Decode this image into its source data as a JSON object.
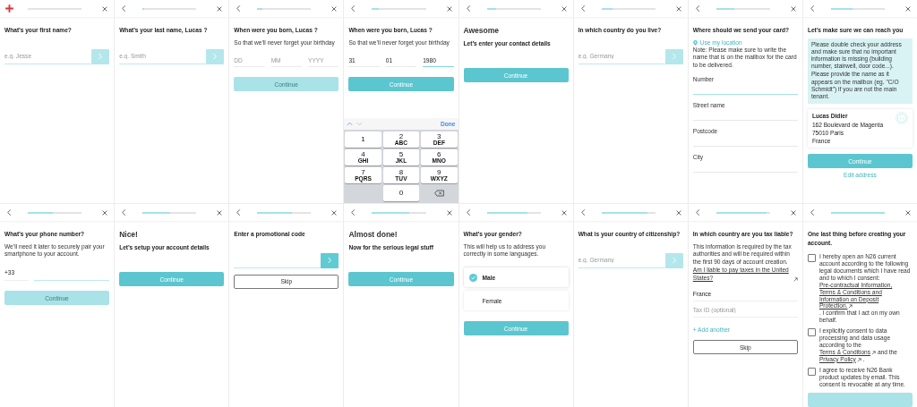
{
  "screens": [
    {
      "header": {
        "kind": "flag",
        "progress": {
          "level": 0
        }
      },
      "items": [
        {
          "kind": "title",
          "text": "What’s your first name?"
        },
        {
          "kind": "input_arrow",
          "placeholder": "e.g. Jesse",
          "enabled": false
        }
      ]
    },
    {
      "header": {
        "kind": "back",
        "progress": {
          "level": 0.03
        }
      },
      "items": [
        {
          "kind": "title",
          "text": "What’s your last name, Lucas ?"
        },
        {
          "kind": "input_arrow",
          "placeholder": "e.g. Smith",
          "enabled": false
        }
      ]
    },
    {
      "header": {
        "kind": "back",
        "progress": {
          "level": 0.1
        }
      },
      "items": [
        {
          "kind": "title",
          "text": "When were you born, Lucas ?"
        },
        {
          "kind": "text",
          "text": "So that we’ll never forget your birthday"
        },
        {
          "kind": "date",
          "fields": [
            {
              "placeholder": "DD",
              "active": false
            },
            {
              "placeholder": "MM",
              "active": false
            },
            {
              "placeholder": "YYYY",
              "active": false
            }
          ]
        },
        {
          "kind": "button",
          "label": "Continue",
          "disabled": true
        }
      ]
    },
    {
      "header": {
        "kind": "back",
        "progress": {
          "level": 0.12
        }
      },
      "items": [
        {
          "kind": "title",
          "text": "When were you born, Lucas ?"
        },
        {
          "kind": "text",
          "text": "So that we’ll never forget your birthday"
        },
        {
          "kind": "date",
          "fields": [
            {
              "value": "31",
              "active": false
            },
            {
              "value": "01",
              "active": false
            },
            {
              "value": "1980",
              "active": true
            }
          ]
        },
        {
          "kind": "button",
          "label": "Continue",
          "disabled": false
        },
        {
          "kind": "keypad",
          "done": "Done",
          "keys": [
            {
              "digit": "1"
            },
            {
              "digit": "2",
              "letters": "ABC"
            },
            {
              "digit": "3",
              "letters": "DEF"
            },
            {
              "digit": "4",
              "letters": "GHI"
            },
            {
              "digit": "5",
              "letters": "JKL"
            },
            {
              "digit": "6",
              "letters": "MNO"
            },
            {
              "digit": "7",
              "letters": "PQRS"
            },
            {
              "digit": "8",
              "letters": "TUV"
            },
            {
              "digit": "9",
              "letters": "WXYZ"
            },
            {
              "digit": "0"
            }
          ]
        }
      ]
    },
    {
      "header": {
        "kind": "back",
        "progress": {
          "level": 0.18
        }
      },
      "items": [
        {
          "kind": "heading",
          "text": "Awesome"
        },
        {
          "kind": "lead",
          "text": "Let’s enter your contact details"
        },
        {
          "kind": "button",
          "label": "Continue",
          "disabled": false
        }
      ]
    },
    {
      "header": {
        "kind": "back",
        "progress": {
          "level": 0.2
        }
      },
      "items": [
        {
          "kind": "title",
          "text": "In which country do you live?"
        },
        {
          "kind": "input_arrow",
          "placeholder": "e.g. Germany",
          "enabled": false
        }
      ]
    },
    {
      "header": {
        "kind": "back",
        "progress": {
          "level": 0.34
        }
      },
      "items": [
        {
          "kind": "title",
          "text": "Where should we send your card?"
        },
        {
          "kind": "location",
          "text": "Use my location"
        },
        {
          "kind": "note",
          "text": "Note: Please make sure to write the name that is on the mailbox for the card to be delivered."
        },
        {
          "kind": "labeled_field",
          "label": "Number",
          "active": true
        },
        {
          "kind": "labeled_field",
          "label": "Street name",
          "active": false
        },
        {
          "kind": "labeled_field",
          "label": "Postcode",
          "active": false
        },
        {
          "kind": "labeled_field",
          "label": "City",
          "active": false
        }
      ]
    },
    {
      "header": {
        "kind": "back",
        "progress": {
          "level": 0.4
        }
      },
      "items": [
        {
          "kind": "title",
          "text": "Let’s make sure we can reach you"
        },
        {
          "kind": "info",
          "paragraphs": [
            "Please double check your address and make sure that no important information is missing (building number, stairwell, door code...).",
            "Please provide the name as it appears on the mailbox (eg. \"C/O Schmidt\") if you are not the main tenant."
          ]
        },
        {
          "kind": "address",
          "lines": [
            "Lucas Didier",
            "162 Boulevard de Magenta",
            "75010 Paris",
            "France"
          ]
        },
        {
          "kind": "button",
          "label": "Continue",
          "disabled": false
        },
        {
          "kind": "link",
          "text": "Edit address"
        }
      ]
    },
    {
      "header": {
        "kind": "back",
        "progress": {
          "level": 0.46
        }
      },
      "items": [
        {
          "kind": "title",
          "text": "What’s your phone number?"
        },
        {
          "kind": "text",
          "text": "We’ll need it later to securely pair your smartphone to your account."
        },
        {
          "kind": "phone",
          "prefix": "+33"
        },
        {
          "kind": "button",
          "label": "Continue",
          "disabled": true
        }
      ]
    },
    {
      "header": {
        "kind": "back",
        "progress": {
          "level": 0.52
        }
      },
      "items": [
        {
          "kind": "heading",
          "text": "Nice!"
        },
        {
          "kind": "lead",
          "text": "Let’s setup your account details"
        },
        {
          "kind": "button",
          "label": "Continue",
          "disabled": false
        }
      ]
    },
    {
      "header": {
        "kind": "back",
        "progress": {
          "level": 0.64
        }
      },
      "items": [
        {
          "kind": "title",
          "text": "Enter a promotional code"
        },
        {
          "kind": "input_arrow",
          "enabled": true
        },
        {
          "kind": "outline_button",
          "label": "Skip",
          "disabled": false
        }
      ]
    },
    {
      "header": {
        "kind": "back",
        "progress": {
          "level": 0.7
        }
      },
      "items": [
        {
          "kind": "heading",
          "text": "Almost done!"
        },
        {
          "kind": "lead",
          "text": "Now for the serious legal stuff"
        },
        {
          "kind": "button",
          "label": "Continue",
          "disabled": false
        }
      ]
    },
    {
      "header": {
        "kind": "back",
        "progress": {
          "level": 0.76
        }
      },
      "items": [
        {
          "kind": "title",
          "text": "What’s your gender?"
        },
        {
          "kind": "text",
          "text": "This will help us to address you correctly in some languages."
        },
        {
          "kind": "choices",
          "options": [
            {
              "label": "Male",
              "selected": true
            },
            {
              "label": "Female",
              "selected": false
            }
          ]
        },
        {
          "kind": "button",
          "label": "Continue",
          "disabled": false
        }
      ]
    },
    {
      "header": {
        "kind": "back",
        "progress": {
          "level": 0.85
        }
      },
      "items": [
        {
          "kind": "title",
          "text": "What is your country of citizenship?"
        },
        {
          "kind": "input_arrow",
          "placeholder": "e.g. Germany",
          "enabled": false
        }
      ]
    },
    {
      "header": {
        "kind": "back",
        "progress": {
          "level": 0.93
        }
      },
      "items": [
        {
          "kind": "title",
          "text": "In which country are you tax liable?"
        },
        {
          "kind": "text",
          "text": "This information is required by the tax authorities and will be required within the first 90 days of account creation."
        },
        {
          "kind": "ext_link",
          "text": "Am I liable to pay taxes in the United States?"
        },
        {
          "kind": "plain_field",
          "value": "France"
        },
        {
          "kind": "plain_field",
          "placeholder": "Tax ID (optional)"
        },
        {
          "kind": "link",
          "text": "+ Add another"
        },
        {
          "kind": "outline_button",
          "label": "Skip",
          "disabled": false
        }
      ]
    },
    {
      "header": {
        "kind": "back",
        "progress": {
          "level": 1
        }
      },
      "items": [
        {
          "kind": "title",
          "text": "One last thing before creating your account."
        },
        {
          "kind": "consent",
          "checked": false,
          "segments": [
            {
              "kind": "text",
              "text": "I hereby open an N26 current account according to the following legal documents which I have read and to which I consent:"
            },
            {
              "kind": "link_line",
              "text": "Pre-contractual Information,"
            },
            {
              "kind": "link_line",
              "text": "Terms & Conditions and"
            },
            {
              "kind": "link_line",
              "text": "Information on Deposit"
            },
            {
              "kind": "link_line",
              "text": "Protection.",
              "external": true
            },
            {
              "kind": "text",
              "text": ". I confirm that I act on my own behalf."
            }
          ]
        },
        {
          "kind": "consent",
          "checked": false,
          "segments": [
            {
              "kind": "text",
              "text": "I explicitly consent to data processing and data usage according to the"
            },
            {
              "kind": "link",
              "text": "Terms & Conditions",
              "external": true
            },
            {
              "kind": "text",
              "text": "and the"
            },
            {
              "kind": "link",
              "text": "Privacy Policy",
              "external": true
            },
            {
              "kind": "text",
              "text": "."
            }
          ]
        },
        {
          "kind": "consent",
          "checked": false,
          "segments": [
            {
              "kind": "text",
              "text": "I agree to receive N26 Bank product updates by email. This consent is revocable at any time."
            }
          ]
        },
        {
          "kind": "button",
          "disabled": true
        }
      ]
    }
  ]
}
